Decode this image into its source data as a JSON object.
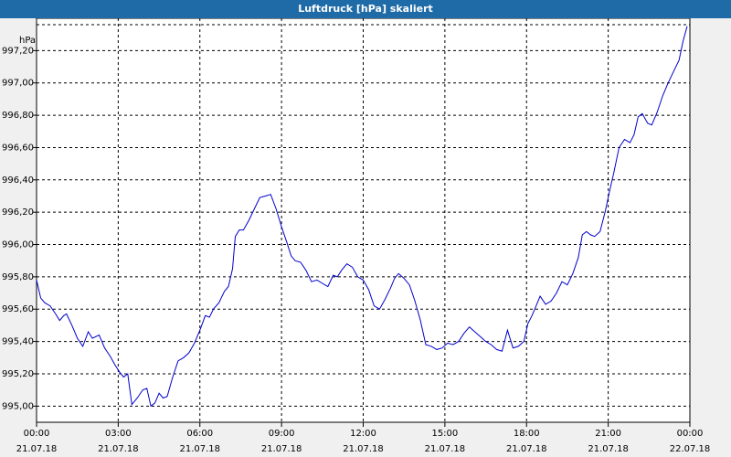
{
  "window": {
    "title": "Luftdruck [hPa] skaliert"
  },
  "colors": {
    "titlebar": "#1f6ba7",
    "line": "#0000cc",
    "grid": "#000000",
    "background": "#f0f0f0"
  },
  "chart_data": {
    "type": "line",
    "title": "Luftdruck [hPa] skaliert",
    "ylabel": "hPa",
    "xlabel": "",
    "xlim": [
      0,
      24
    ],
    "ylim": [
      994.9,
      997.4
    ],
    "grid": true,
    "y_ticks": [
      {
        "value": 995.0,
        "label": "995,00"
      },
      {
        "value": 995.2,
        "label": "995,20"
      },
      {
        "value": 995.4,
        "label": "995,40"
      },
      {
        "value": 995.6,
        "label": "995,60"
      },
      {
        "value": 995.8,
        "label": "995,80"
      },
      {
        "value": 996.0,
        "label": "996,00"
      },
      {
        "value": 996.2,
        "label": "996,20"
      },
      {
        "value": 996.4,
        "label": "996,40"
      },
      {
        "value": 996.6,
        "label": "996,60"
      },
      {
        "value": 996.8,
        "label": "996,80"
      },
      {
        "value": 997.0,
        "label": "997,00"
      },
      {
        "value": 997.2,
        "label": "997,20"
      }
    ],
    "x_ticks": [
      {
        "value": 0,
        "time": "00:00",
        "date": "21.07.18"
      },
      {
        "value": 3,
        "time": "03:00",
        "date": "21.07.18"
      },
      {
        "value": 6,
        "time": "06:00",
        "date": "21.07.18"
      },
      {
        "value": 9,
        "time": "09:00",
        "date": "21.07.18"
      },
      {
        "value": 12,
        "time": "12:00",
        "date": "21.07.18"
      },
      {
        "value": 15,
        "time": "15:00",
        "date": "21.07.18"
      },
      {
        "value": 18,
        "time": "18:00",
        "date": "21.07.18"
      },
      {
        "value": 21,
        "time": "21:00",
        "date": "21.07.18"
      },
      {
        "value": 24,
        "time": "00:00",
        "date": "22.07.18"
      }
    ],
    "series": [
      {
        "name": "",
        "x": [
          0.0,
          0.15,
          0.3,
          0.5,
          0.7,
          0.85,
          1.0,
          1.1,
          1.3,
          1.5,
          1.7,
          1.9,
          2.05,
          2.3,
          2.5,
          2.7,
          2.9,
          3.05,
          3.2,
          3.35,
          3.5,
          3.7,
          3.9,
          4.05,
          4.2,
          4.35,
          4.5,
          4.65,
          4.8,
          5.0,
          5.2,
          5.4,
          5.6,
          5.8,
          6.0,
          6.2,
          6.35,
          6.5,
          6.7,
          6.9,
          7.05,
          7.2,
          7.3,
          7.45,
          7.6,
          7.8,
          8.0,
          8.2,
          8.4,
          8.6,
          8.8,
          9.0,
          9.2,
          9.35,
          9.5,
          9.7,
          9.9,
          10.1,
          10.3,
          10.5,
          10.7,
          10.9,
          11.05,
          11.2,
          11.4,
          11.6,
          11.8,
          12.0,
          12.2,
          12.4,
          12.6,
          12.8,
          13.0,
          13.15,
          13.3,
          13.5,
          13.7,
          13.9,
          14.1,
          14.3,
          14.5,
          14.7,
          14.9,
          15.1,
          15.3,
          15.5,
          15.7,
          15.9,
          16.1,
          16.3,
          16.5,
          16.7,
          16.9,
          17.1,
          17.3,
          17.5,
          17.7,
          17.9,
          18.05,
          18.2,
          18.35,
          18.5,
          18.7,
          18.9,
          19.1,
          19.3,
          19.5,
          19.7,
          19.9,
          20.05,
          20.2,
          20.35,
          20.5,
          20.7,
          20.9,
          21.05,
          21.2,
          21.4,
          21.6,
          21.8,
          21.95,
          22.1,
          22.25,
          22.45,
          22.6,
          22.8,
          23.0,
          23.2,
          23.4,
          23.6,
          23.75,
          23.9
        ],
        "values": [
          995.78,
          995.67,
          995.64,
          995.62,
          995.57,
          995.53,
          995.56,
          995.57,
          995.5,
          995.42,
          995.37,
          995.46,
          995.42,
          995.44,
          995.36,
          995.31,
          995.25,
          995.21,
          995.18,
          995.2,
          995.01,
          995.05,
          995.1,
          995.11,
          995.0,
          995.02,
          995.08,
          995.05,
          995.06,
          995.18,
          995.28,
          995.3,
          995.33,
          995.39,
          995.47,
          995.56,
          995.55,
          995.6,
          995.64,
          995.71,
          995.74,
          995.85,
          996.05,
          996.09,
          996.09,
          996.15,
          996.22,
          996.29,
          996.3,
          996.31,
          996.22,
          996.11,
          996.01,
          995.93,
          995.9,
          995.89,
          995.84,
          995.77,
          995.78,
          995.76,
          995.74,
          995.81,
          995.8,
          995.84,
          995.88,
          995.86,
          995.8,
          995.78,
          995.72,
          995.62,
          995.6,
          995.66,
          995.73,
          995.79,
          995.82,
          995.79,
          995.75,
          995.65,
          995.53,
          995.38,
          995.37,
          995.35,
          995.36,
          995.39,
          995.38,
          995.4,
          995.45,
          995.49,
          995.46,
          995.43,
          995.4,
          995.38,
          995.35,
          995.34,
          995.47,
          995.36,
          995.37,
          995.4,
          995.51,
          995.56,
          995.62,
          995.68,
          995.63,
          995.65,
          995.7,
          995.77,
          995.75,
          995.82,
          995.92,
          996.06,
          996.08,
          996.06,
          996.05,
          996.08,
          996.21,
          996.33,
          996.44,
          996.6,
          996.65,
          996.63,
          996.68,
          996.79,
          996.81,
          996.75,
          996.74,
          996.82,
          996.92,
          997.0,
          997.07,
          997.14,
          997.26,
          997.35
        ]
      }
    ]
  }
}
